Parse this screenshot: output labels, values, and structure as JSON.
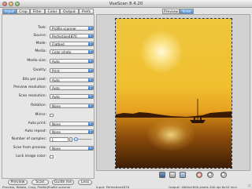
{
  "window": {
    "title": "VueScan 8.4.20"
  },
  "tabs": [
    {
      "label": "Input",
      "active": true
    },
    {
      "label": "Crop",
      "active": false
    },
    {
      "label": "Filter",
      "active": false
    },
    {
      "label": "Color",
      "active": false
    },
    {
      "label": "Output",
      "active": false
    },
    {
      "label": "Prefs",
      "active": false
    }
  ],
  "preview_tabs": [
    {
      "label": "Preview",
      "active": false
    },
    {
      "label": "Scan",
      "active": true
    }
  ],
  "settings": {
    "task": {
      "label": "Task:",
      "value": "Profile scanner"
    },
    "source": {
      "label": "Source:",
      "value": "Perfection4870"
    },
    "mode": {
      "label": "Mode:",
      "value": "Flatbed"
    },
    "media": {
      "label": "Media:",
      "value": "Color photo"
    },
    "media_size": {
      "label": "Media size:",
      "value": "Auto"
    },
    "quality": {
      "label": "Quality:",
      "value": "Print"
    },
    "bits_per_pixel": {
      "label": "Bits per pixel:",
      "value": "Auto"
    },
    "preview_resolution": {
      "label": "Preview resolution:",
      "value": "Auto"
    },
    "scan_resolution": {
      "label": "Scan resolution:",
      "value": "Auto"
    },
    "rotation": {
      "label": "Rotation:",
      "value": "None"
    },
    "mirror": {
      "label": "Mirror:"
    },
    "auto_print": {
      "label": "Auto print:",
      "value": "None"
    },
    "auto_repeat": {
      "label": "Auto repeat:",
      "value": "None"
    },
    "number_of_samples": {
      "label": "Number of samples:",
      "value": "1"
    },
    "scan_from_preview": {
      "label": "Scan from preview:",
      "value": "None"
    },
    "lock_image_color": {
      "label": "Lock image color:"
    }
  },
  "buttons": {
    "preview": "Preview",
    "scan": "Scan",
    "guide_me": "Guide me",
    "less": "Less"
  },
  "toolbar_icons": [
    "save-icon",
    "print-icon",
    "mail-icon",
    "rotate-icon",
    "zoom-in-icon",
    "zoom-out-icon"
  ],
  "status": {
    "left": "Preview, Rotate, Crop, Profile|Profile scanner",
    "middle": "Input: Perfection4870",
    "right": "Output: 1600x2000 pixels 200 dpi 8x10 inch"
  },
  "colors": {
    "accent": "#3f85d6",
    "sky": "#eec63c",
    "water": "#6a3a08"
  }
}
